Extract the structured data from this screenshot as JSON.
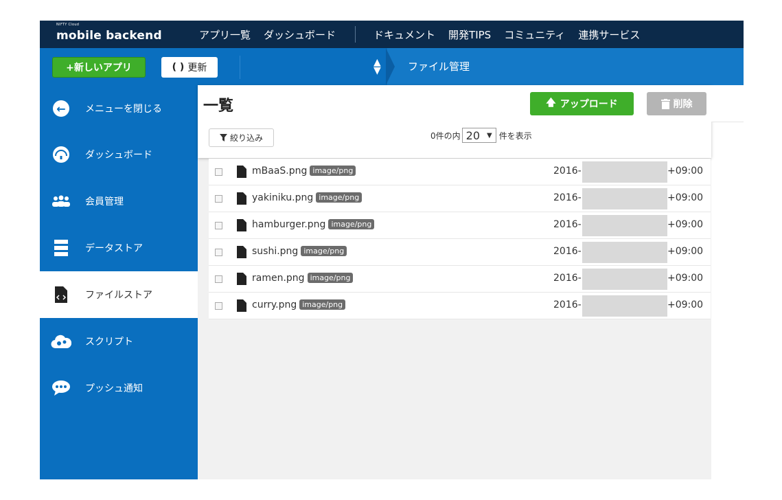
{
  "header": {
    "logo_small": "NIFTY Cloud",
    "logo_main": "mobile backend",
    "nav": [
      "アプリ一覧",
      "ダッシュボード",
      "ドキュメント",
      "開発TIPS",
      "コミュニティ",
      "連携サービス"
    ]
  },
  "toolbar": {
    "new_app_label": "+新しいアプリ",
    "refresh_label": "更新",
    "breadcrumb": "ファイル管理"
  },
  "sidebar": {
    "items": [
      {
        "label": "メニューを閉じる",
        "icon": "arrow-left-icon"
      },
      {
        "label": "ダッシュボード",
        "icon": "dashboard-gauge-icon"
      },
      {
        "label": "会員管理",
        "icon": "users-icon"
      },
      {
        "label": "データストア",
        "icon": "datastore-icon"
      },
      {
        "label": "ファイルストア",
        "icon": "file-code-icon"
      },
      {
        "label": "スクリプト",
        "icon": "cloud-gear-icon"
      },
      {
        "label": "プッシュ通知",
        "icon": "chat-bubble-icon"
      }
    ]
  },
  "main": {
    "title": "一覧",
    "upload_label": "アップロード",
    "delete_label": "削除",
    "filter_label": "絞り込み",
    "count_prefix": "0件の内",
    "page_size": "20",
    "count_suffix": "件を表示"
  },
  "files": [
    {
      "name": "mBaaS.png",
      "type": "image/png",
      "date_prefix": "2016-",
      "date_suffix": "+09:00"
    },
    {
      "name": "yakiniku.png",
      "type": "image/png",
      "date_prefix": "2016-",
      "date_suffix": "+09:00"
    },
    {
      "name": "hamburger.png",
      "type": "image/png",
      "date_prefix": "2016-",
      "date_suffix": "+09:00"
    },
    {
      "name": "sushi.png",
      "type": "image/png",
      "date_prefix": "2016-",
      "date_suffix": "+09:00"
    },
    {
      "name": "ramen.png",
      "type": "image/png",
      "date_prefix": "2016-",
      "date_suffix": "+09:00"
    },
    {
      "name": "curry.png",
      "type": "image/png",
      "date_prefix": "2016-",
      "date_suffix": "+09:00"
    }
  ],
  "colors": {
    "header_bg": "#0c2a4a",
    "primary_blue": "#0a6fbf",
    "action_green": "#3fae2a",
    "disabled_gray": "#b5b5b5"
  }
}
